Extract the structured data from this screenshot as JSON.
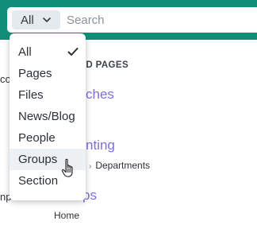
{
  "search": {
    "scope_value": "All",
    "placeholder": "Search"
  },
  "background": {
    "recent_heading_fragment": "WED PAGES",
    "link_1_fragment": "ches",
    "link_2_fragment": "nting",
    "link_2_breadcrumb_fragment": "Departments",
    "link_3_fragment": "ps",
    "link_3_breadcrumb": "Home",
    "left_fragment_1": "co",
    "left_fragment_2": "np"
  },
  "dropdown": {
    "items": [
      {
        "label": "All",
        "selected": true
      },
      {
        "label": "Pages",
        "selected": false
      },
      {
        "label": "Files",
        "selected": false
      },
      {
        "label": "News/Blog",
        "selected": false
      },
      {
        "label": "People",
        "selected": false
      },
      {
        "label": "Groups",
        "selected": false,
        "hovered": true
      },
      {
        "label": "Section",
        "selected": false
      }
    ]
  },
  "colors": {
    "topbar": "#0f8f7a",
    "link": "#7b6fe0",
    "hover": "#eef1f3"
  }
}
